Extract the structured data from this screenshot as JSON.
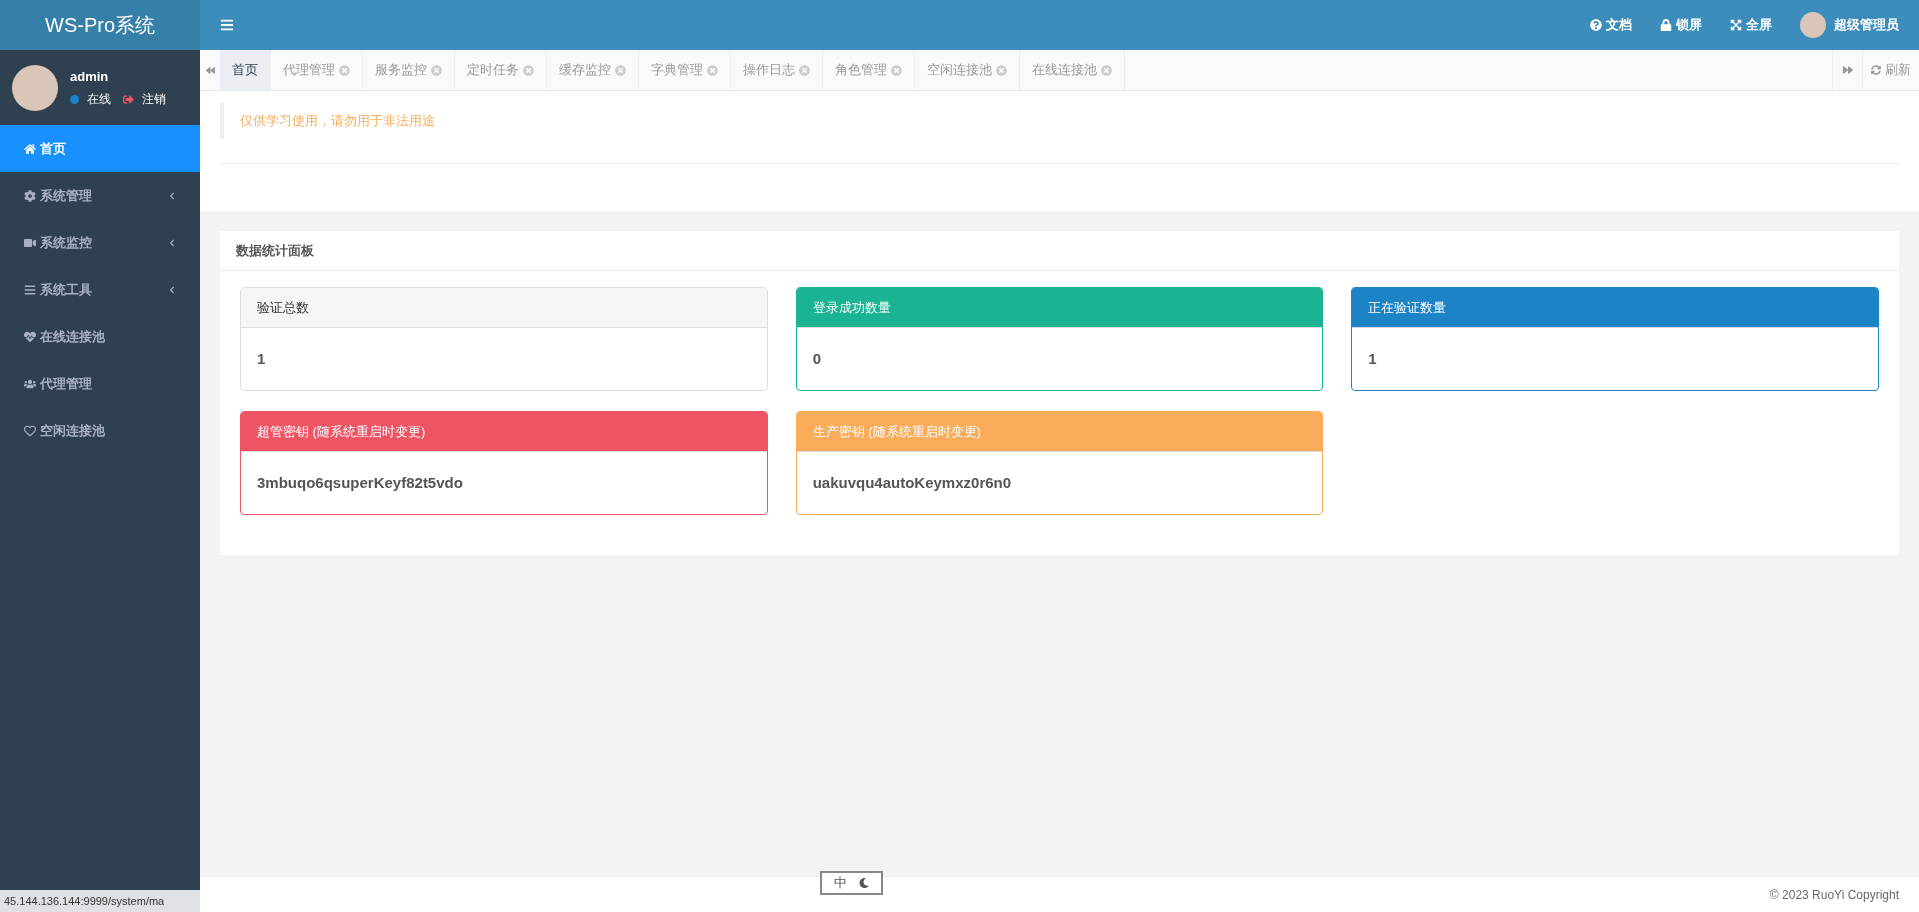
{
  "brand": "WS-Pro系统",
  "header": {
    "actions": [
      {
        "kind": "help",
        "label": "文档"
      },
      {
        "kind": "lock",
        "label": "锁屏"
      },
      {
        "kind": "fullscreen",
        "label": "全屏"
      }
    ],
    "user": "超级管理员"
  },
  "user_panel": {
    "name": "admin",
    "status": "在线",
    "logout": "注销"
  },
  "sidebar": {
    "items": [
      {
        "kind": "home",
        "label": "首页",
        "selected": true,
        "submenu": false
      },
      {
        "kind": "gear",
        "label": "系统管理",
        "selected": false,
        "submenu": true
      },
      {
        "kind": "video",
        "label": "系统监控",
        "selected": false,
        "submenu": true
      },
      {
        "kind": "bars",
        "label": "系统工具",
        "selected": false,
        "submenu": true
      },
      {
        "kind": "heartbeat",
        "label": "在线连接池",
        "selected": false,
        "submenu": false
      },
      {
        "kind": "users",
        "label": "代理管理",
        "selected": false,
        "submenu": false
      },
      {
        "kind": "heart",
        "label": "空闲连接池",
        "selected": false,
        "submenu": false
      }
    ]
  },
  "tabs": [
    {
      "label": "首页",
      "selected": true,
      "closable": false
    },
    {
      "label": "代理管理",
      "selected": false,
      "closable": true
    },
    {
      "label": "服务监控",
      "selected": false,
      "closable": true
    },
    {
      "label": "定时任务",
      "selected": false,
      "closable": true
    },
    {
      "label": "缓存监控",
      "selected": false,
      "closable": true
    },
    {
      "label": "字典管理",
      "selected": false,
      "closable": true
    },
    {
      "label": "操作日志",
      "selected": false,
      "closable": true
    },
    {
      "label": "角色管理",
      "selected": false,
      "closable": true
    },
    {
      "label": "空闲连接池",
      "selected": false,
      "closable": true
    },
    {
      "label": "在线连接池",
      "selected": false,
      "closable": true
    }
  ],
  "refresh": "刷新",
  "notice": "仅供学习使用，请勿用于非法用途",
  "panel": {
    "title": "数据统计面板",
    "cards": [
      {
        "title": "验证总数",
        "value": "1",
        "color": "#f5f5f5",
        "title_dark": true
      },
      {
        "title": "登录成功数量",
        "value": "0",
        "color": "#1ab394",
        "title_dark": false
      },
      {
        "title": "正在验证数量",
        "value": "1",
        "color": "#1c84c6",
        "title_dark": false
      },
      {
        "title": "超管密钥 (随系统重启时变更)",
        "value": "3mbuqo6qsuperKeyf82t5vdo",
        "color": "#ed5565",
        "title_dark": false
      },
      {
        "title": "生产密钥 (随系统重启时变更)",
        "value": "uakuvqu4autoKeymxz0r6n0",
        "color": "#f8ac59",
        "title_dark": false
      }
    ]
  },
  "ime": "中",
  "footer": "© 2023 RuoYi Copyright",
  "status_url": "45.144.136.144:9999/system/ma"
}
